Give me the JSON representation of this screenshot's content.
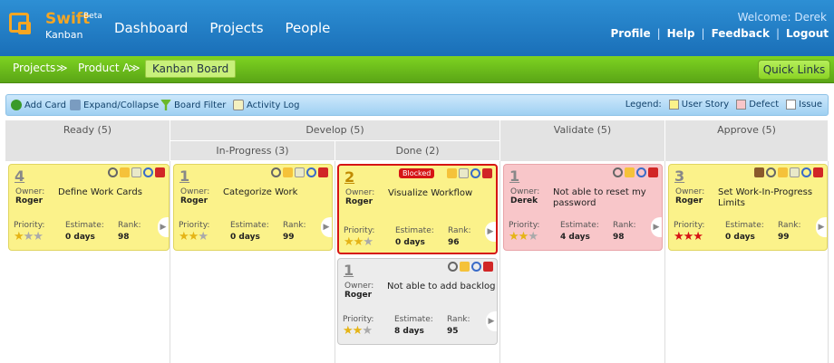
{
  "header": {
    "logo_main": "Swift",
    "logo_sup": "Beta",
    "logo_sub": "Kanban",
    "nav": [
      "Dashboard",
      "Projects",
      "People"
    ],
    "welcome": "Welcome: Derek",
    "links": [
      "Profile",
      "Help",
      "Feedback",
      "Logout"
    ]
  },
  "breadcrumb": {
    "items": [
      "Projects",
      "Product A"
    ],
    "current": "Kanban Board",
    "sep": "≫"
  },
  "quick_links": "Quick Links",
  "toolbar": {
    "add": "Add Card",
    "expand": "Expand/Collapse",
    "filter": "Board Filter",
    "log": "Activity Log",
    "legend_label": "Legend:",
    "legend": [
      {
        "label": "User Story",
        "color": "#fbf28a"
      },
      {
        "label": "Defect",
        "color": "#f8c6c9"
      },
      {
        "label": "Issue",
        "color": "#ffffff"
      }
    ]
  },
  "columns": {
    "ready": "Ready (5)",
    "develop": "Develop (5)",
    "inprogress": "In-Progress (3)",
    "done": "Done (2)",
    "validate": "Validate (5)",
    "approve": "Approve (5)"
  },
  "labels": {
    "owner": "Owner:",
    "priority": "Priority:",
    "estimate": "Estimate:",
    "rank": "Rank:",
    "blocked": "Blocked"
  },
  "cards": [
    {
      "num": "4",
      "owner": "Roger",
      "title": "Define Work Cards",
      "estimate": "0 days",
      "rank": "98",
      "stars": "★★★",
      "star_colors": [
        "gold",
        "gray",
        "gray"
      ]
    },
    {
      "num": "1",
      "owner": "Roger",
      "title": "Categorize Work",
      "estimate": "0 days",
      "rank": "99",
      "stars": "★★★"
    },
    {
      "num": "2",
      "owner": "Roger",
      "title": "Visualize Workflow",
      "estimate": "0 days",
      "rank": "96",
      "stars": "★★★"
    },
    {
      "num": "1",
      "owner": "Roger",
      "title": "Not able to add backlog",
      "estimate": "8 days",
      "rank": "95",
      "stars": "★★★"
    },
    {
      "num": "1",
      "owner": "Derek",
      "title": "Not able to reset my password",
      "estimate": "4 days",
      "rank": "98",
      "stars": "★★★"
    },
    {
      "num": "3",
      "owner": "Roger",
      "title": "Set Work-In-Progress Limits",
      "estimate": "0 days",
      "rank": "99",
      "stars": "★★★"
    }
  ]
}
